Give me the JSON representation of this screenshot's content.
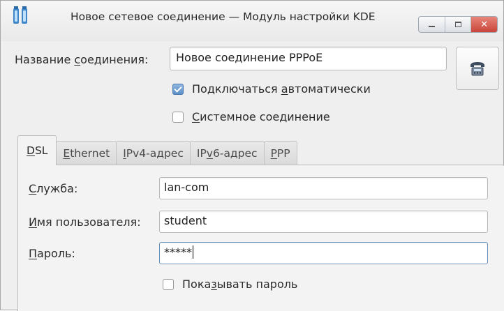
{
  "window": {
    "title": "Новое сетевое соединение — Модуль настройки KDE",
    "close_glyph": "✕"
  },
  "connection": {
    "name_label_prefix": "Название ",
    "name_label_accel": "с",
    "name_label_suffix": "оединения:",
    "name_value": "Новое соединение PPPoE",
    "icon": "telephone-icon"
  },
  "options": {
    "auto_connect": {
      "prefix": "Подключаться ",
      "accel": "а",
      "suffix": "втоматически",
      "checked": true
    },
    "system_connection": {
      "prefix": "",
      "accel": "С",
      "suffix": "истемное соединение",
      "checked": false
    }
  },
  "tabs": [
    {
      "accel": "D",
      "rest": "SL",
      "active": true
    },
    {
      "accel": "E",
      "rest": "thernet",
      "active": false
    },
    {
      "accel": "I",
      "rest": "Pv4-адрес",
      "active": false
    },
    {
      "prefix": "IP",
      "accel": "v",
      "rest": "6-адрес",
      "active": false
    },
    {
      "accel": "P",
      "rest": "PP",
      "active": false
    }
  ],
  "dsl": {
    "service": {
      "accel": "С",
      "rest": "лужба:",
      "value": "lan-com"
    },
    "username": {
      "accel": "И",
      "rest": "мя пользователя:",
      "value": "student"
    },
    "password": {
      "accel": "П",
      "rest": "ароль:",
      "value": "*****"
    },
    "show_password": {
      "prefix": "Пока",
      "accel": "з",
      "suffix": "ывать пароль",
      "checked": false
    }
  }
}
